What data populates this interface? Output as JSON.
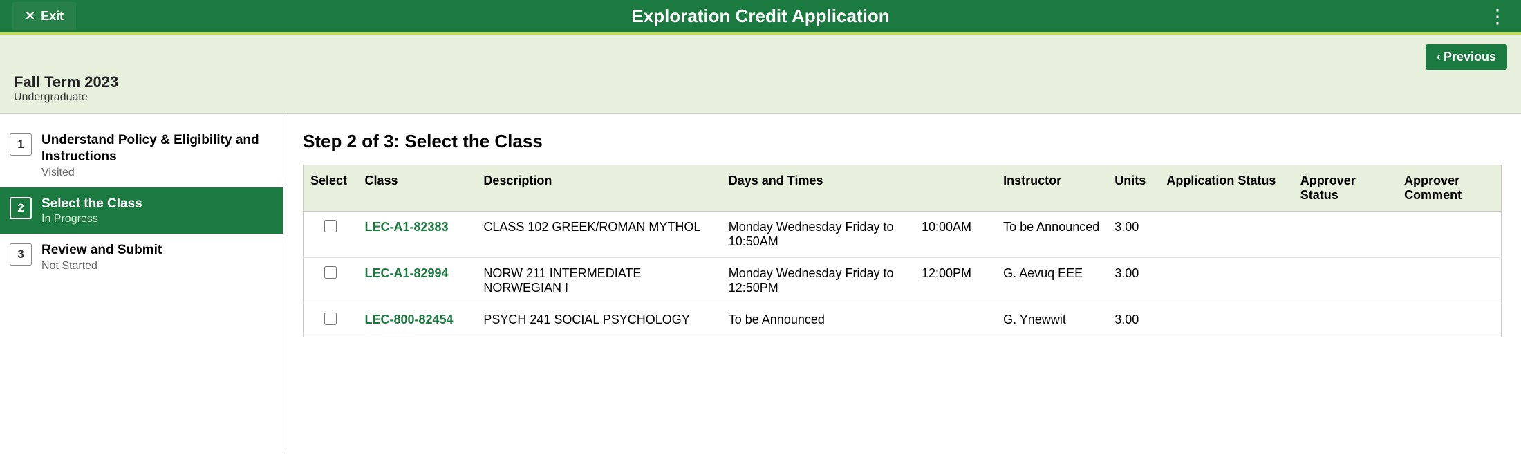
{
  "header": {
    "exit_label": "Exit",
    "title": "Exploration Credit Application",
    "previous_label": "Previous"
  },
  "term": {
    "title": "Fall Term 2023",
    "level": "Undergraduate"
  },
  "steps": [
    {
      "num": "1",
      "title": "Understand Policy & Eligibility and Instructions",
      "status": "Visited"
    },
    {
      "num": "2",
      "title": "Select the Class",
      "status": "In Progress"
    },
    {
      "num": "3",
      "title": "Review and Submit",
      "status": "Not Started"
    }
  ],
  "content": {
    "heading": "Step 2 of 3: Select the Class",
    "columns": {
      "select": "Select",
      "class": "Class",
      "description": "Description",
      "days_times": "Days and Times",
      "instructor": "Instructor",
      "units": "Units",
      "app_status": "Application Status",
      "appr_status": "Approver Status",
      "appr_comment": "Approver Comment"
    },
    "rows": [
      {
        "class": "LEC-A1-82383",
        "description": "CLASS 102  GREEK/ROMAN MYTHOL",
        "days": "Monday Wednesday Friday to 10:50AM",
        "time": "10:00AM",
        "instructor": "To be Announced",
        "units": "3.00",
        "app_status": "",
        "appr_status": "",
        "appr_comment": ""
      },
      {
        "class": "LEC-A1-82994",
        "description": "NORW 211  INTERMEDIATE NORWEGIAN I",
        "days": "Monday Wednesday Friday to 12:50PM",
        "time": "12:00PM",
        "instructor": "G. Aevuq EEE",
        "units": "3.00",
        "app_status": "",
        "appr_status": "",
        "appr_comment": ""
      },
      {
        "class": "LEC-800-82454",
        "description": "PSYCH 241  SOCIAL PSYCHOLOGY",
        "days": "To be Announced",
        "time": "",
        "instructor": "G. Ynewwit",
        "units": "3.00",
        "app_status": "",
        "appr_status": "",
        "appr_comment": ""
      }
    ]
  }
}
